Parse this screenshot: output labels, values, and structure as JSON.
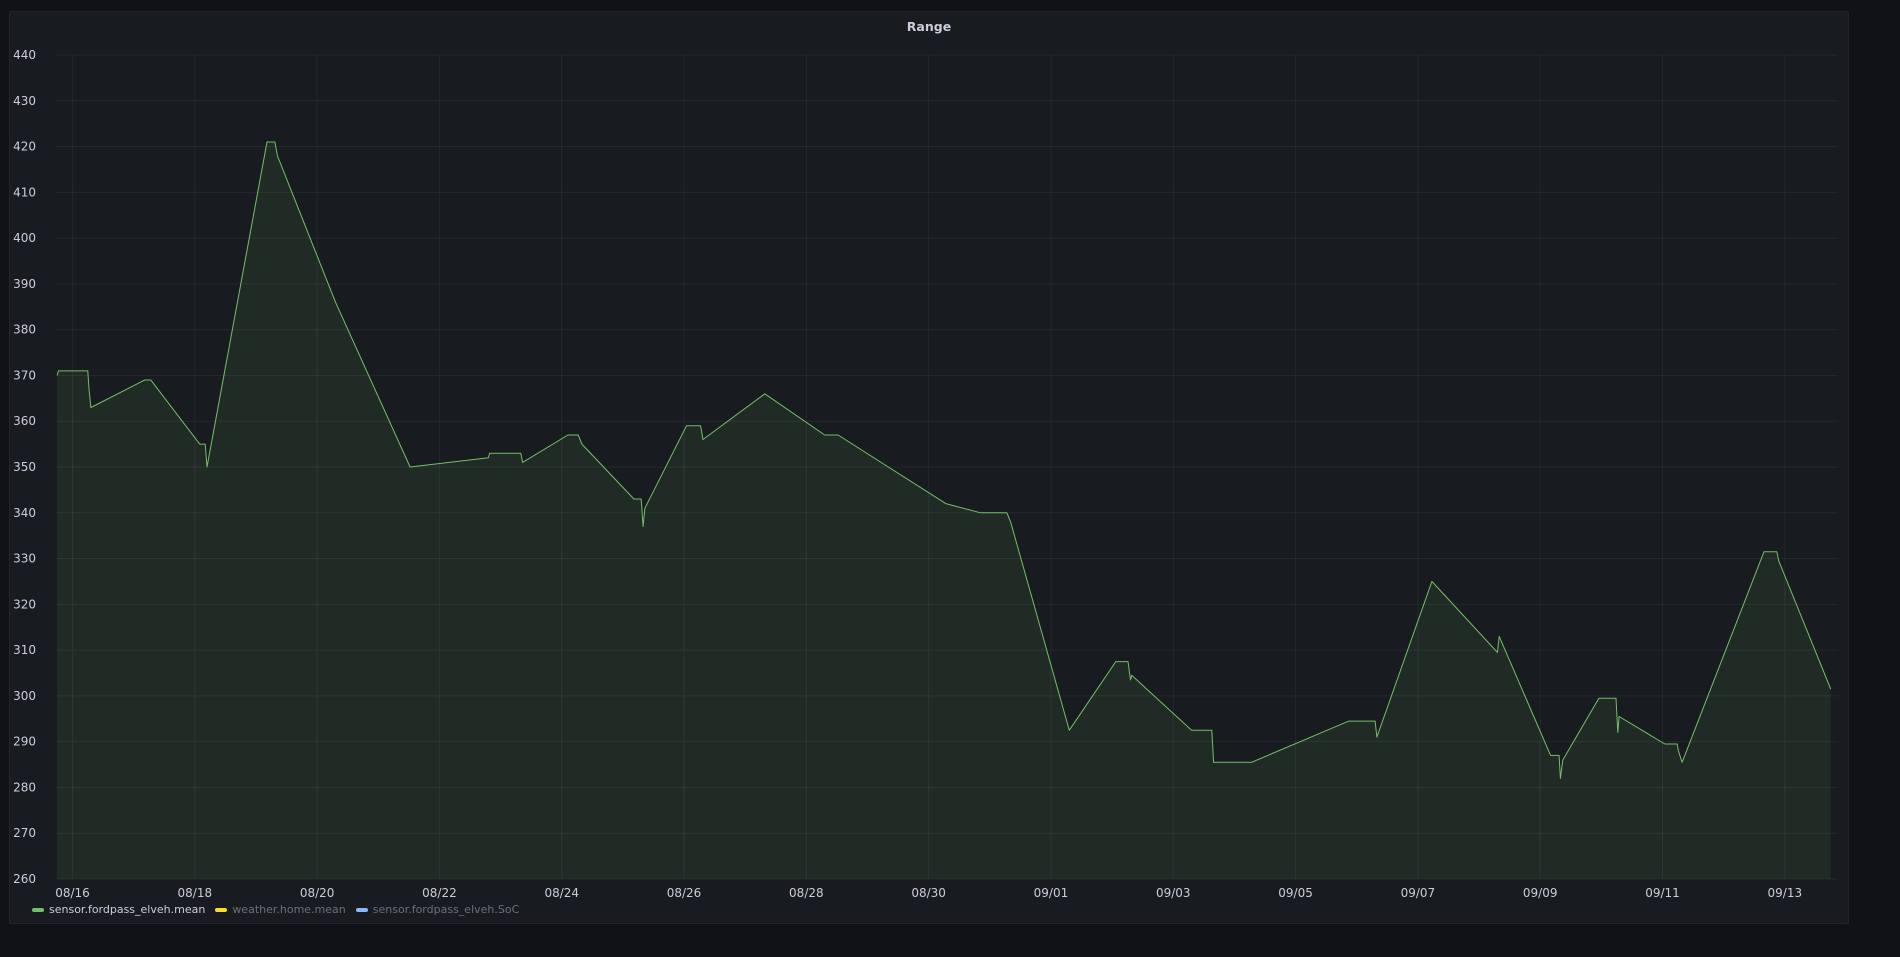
{
  "panel": {
    "title": "Range"
  },
  "legend": [
    {
      "label": "sensor.fordpass_elveh.mean",
      "color": "#73bf69",
      "active": true
    },
    {
      "label": "weather.home.mean",
      "color": "#fade2a",
      "active": false
    },
    {
      "label": "sensor.fordpass_elveh.SoC",
      "color": "#8ab8ff",
      "active": false
    }
  ],
  "chart_data": {
    "type": "area",
    "title": "Range",
    "xlabel": "",
    "ylabel": "",
    "ylim": [
      260,
      440
    ],
    "yticks": [
      260,
      270,
      280,
      290,
      300,
      310,
      320,
      330,
      340,
      350,
      360,
      370,
      380,
      390,
      400,
      410,
      420,
      430,
      440
    ],
    "xticks": [
      "08/16",
      "08/18",
      "08/20",
      "08/22",
      "08/24",
      "08/26",
      "08/28",
      "08/30",
      "09/01",
      "09/03",
      "09/05",
      "09/07",
      "09/09",
      "09/11",
      "09/13"
    ],
    "xlim_days": [
      -0.27,
      28.87
    ],
    "grid": true,
    "legend_position": "bottom-left",
    "series": [
      {
        "name": "sensor.fordpass_elveh.mean",
        "color": "#73bf69",
        "points": [
          [
            -0.25,
            370
          ],
          [
            -0.23,
            371
          ],
          [
            0.25,
            371
          ],
          [
            0.27,
            367
          ],
          [
            0.3,
            363
          ],
          [
            1.18,
            369
          ],
          [
            1.28,
            369
          ],
          [
            2.08,
            355
          ],
          [
            2.17,
            355
          ],
          [
            2.2,
            350
          ],
          [
            3.18,
            421
          ],
          [
            3.31,
            421
          ],
          [
            3.35,
            418
          ],
          [
            4.3,
            386
          ],
          [
            5.52,
            350
          ],
          [
            6.8,
            352
          ],
          [
            6.82,
            353
          ],
          [
            7.33,
            353
          ],
          [
            7.36,
            351
          ],
          [
            8.1,
            357
          ],
          [
            8.27,
            357
          ],
          [
            8.33,
            355
          ],
          [
            9.18,
            343
          ],
          [
            9.3,
            343
          ],
          [
            9.33,
            337
          ],
          [
            9.36,
            341
          ],
          [
            10.04,
            359
          ],
          [
            10.27,
            359
          ],
          [
            10.31,
            356
          ],
          [
            11.32,
            366
          ],
          [
            12.3,
            357
          ],
          [
            12.52,
            357
          ],
          [
            14.28,
            342
          ],
          [
            14.85,
            340
          ],
          [
            15.28,
            340
          ],
          [
            15.34,
            338
          ],
          [
            16.3,
            292.5
          ],
          [
            17.06,
            307.5
          ],
          [
            17.26,
            307.5
          ],
          [
            17.3,
            303.5
          ],
          [
            17.32,
            304.5
          ],
          [
            18.3,
            292.5
          ],
          [
            18.63,
            292.5
          ],
          [
            18.66,
            285.5
          ],
          [
            19.28,
            285.5
          ],
          [
            20.87,
            294.5
          ],
          [
            21.3,
            294.5
          ],
          [
            21.33,
            291
          ],
          [
            22.23,
            325
          ],
          [
            23.3,
            309.5
          ],
          [
            23.33,
            313
          ],
          [
            24.17,
            287
          ],
          [
            24.31,
            287
          ],
          [
            24.33,
            282
          ],
          [
            24.37,
            286
          ],
          [
            24.96,
            299.5
          ],
          [
            25.24,
            299.5
          ],
          [
            25.27,
            292
          ],
          [
            25.29,
            295.5
          ],
          [
            26.04,
            289.5
          ],
          [
            26.24,
            289.5
          ],
          [
            26.26,
            288
          ],
          [
            26.32,
            285.5
          ],
          [
            27.66,
            331.5
          ],
          [
            27.87,
            331.5
          ],
          [
            27.9,
            329.5
          ],
          [
            28.75,
            301.5
          ]
        ]
      }
    ]
  }
}
